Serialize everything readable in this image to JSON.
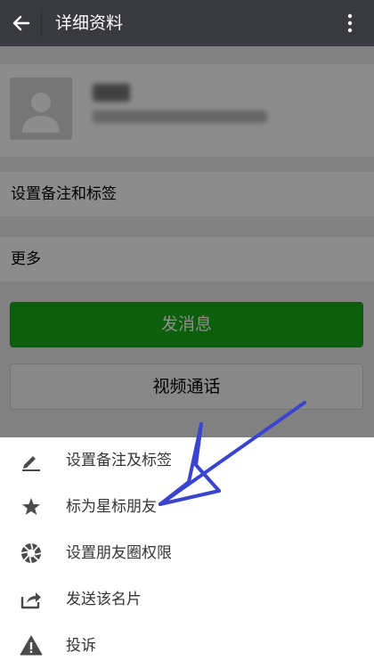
{
  "header": {
    "title": "详细资料",
    "background": "#393a3f"
  },
  "profile": {
    "remark_row_label": "设置备注和标签",
    "more_row_label": "更多",
    "send_message_label": "发消息",
    "video_call_label": "视频通话",
    "accent_color": "#1aad19"
  },
  "action_sheet": {
    "items": [
      {
        "label": "设置备注及标签",
        "icon": "pencil-icon"
      },
      {
        "label": "标为星标朋友",
        "icon": "star-icon"
      },
      {
        "label": "设置朋友圈权限",
        "icon": "aperture-icon"
      },
      {
        "label": "发送该名片",
        "icon": "share-icon"
      },
      {
        "label": "投诉",
        "icon": "warning-icon"
      }
    ]
  },
  "annotation": {
    "arrow_color": "#3a45cf",
    "points_to": "标为星标朋友"
  }
}
